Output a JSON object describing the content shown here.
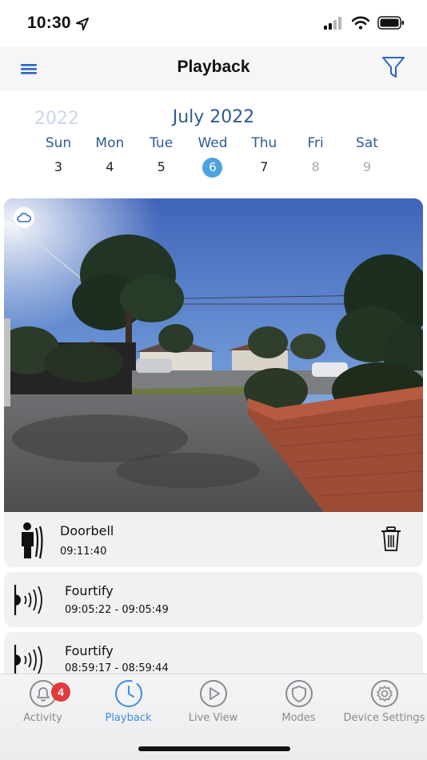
{
  "status_bar": {
    "time": "10:30"
  },
  "header": {
    "title": "Playback"
  },
  "calendar": {
    "prev_year": "2022",
    "month_year": "July 2022",
    "weekdays": [
      "Sun",
      "Mon",
      "Tue",
      "Wed",
      "Thu",
      "Fri",
      "Sat"
    ],
    "days": [
      "3",
      "4",
      "5",
      "6",
      "7",
      "8",
      "9"
    ],
    "selected_day": "6",
    "disabled_days": [
      "8",
      "9"
    ]
  },
  "events": [
    {
      "title": "Doorbell",
      "time": "09:11:40",
      "icon": "person-doorbell-icon",
      "cloud": true
    },
    {
      "title": "Fourtify",
      "time": "09:05:22 - 09:05:49",
      "icon": "motion-sensor-icon"
    },
    {
      "title": "Fourtify",
      "time": "08:59:17 - 08:59:44",
      "icon": "motion-sensor-icon"
    }
  ],
  "tabs": [
    {
      "label": "Activity",
      "icon": "bell-icon",
      "badge": "4",
      "active": false
    },
    {
      "label": "Playback",
      "icon": "clock-icon",
      "active": true
    },
    {
      "label": "Live View",
      "icon": "play-icon",
      "active": false
    },
    {
      "label": "Modes",
      "icon": "shield-icon",
      "active": false
    },
    {
      "label": "Device Settings",
      "icon": "gear-icon",
      "active": false
    }
  ],
  "colors": {
    "accent": "#3d8ee0",
    "calendar_text": "#2f5b8f",
    "selected_day": "#4da3e0",
    "badge": "#e23a3a"
  }
}
